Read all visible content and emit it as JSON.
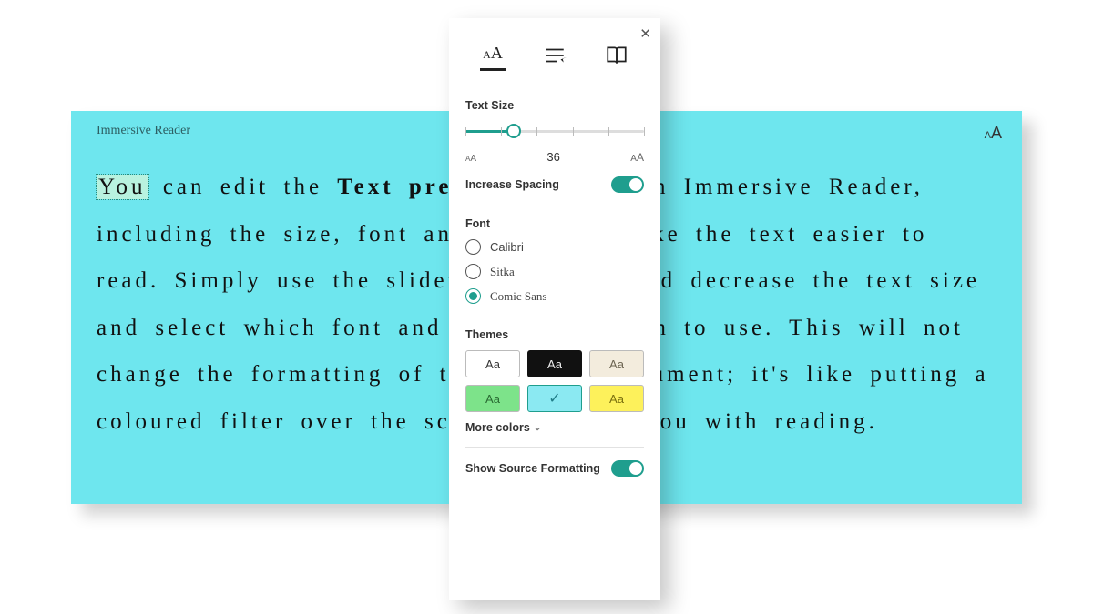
{
  "reader": {
    "title": "Immersive Reader",
    "highlighted_word": "You",
    "body_rest": " can edit the ",
    "bold_fragment": "Text preferences",
    "body_after": " here in Immersive Reader, including the size, font and colour to make the text easier to read. Simply use the slider to increase and decrease the text size and select which font and colour you wish to use. This will not change the formatting of the original document; it's like putting a coloured filter over the screen to assist you with reading."
  },
  "panel": {
    "tabs": {
      "text": "Text Preferences",
      "grammar": "Grammar Options",
      "reading": "Reading Preferences"
    },
    "text_size": {
      "label": "Text Size",
      "value": 36,
      "min": 14,
      "max": 96,
      "small_icon": "A",
      "large_icon": "A"
    },
    "increase_spacing": {
      "label": "Increase Spacing",
      "on": true
    },
    "font": {
      "label": "Font",
      "options": [
        "Calibri",
        "Sitka",
        "Comic Sans"
      ],
      "selected": "Comic Sans"
    },
    "themes": {
      "label": "Themes",
      "sample": "Aa",
      "selected": "cyan",
      "more_label": "More colors"
    },
    "source_formatting": {
      "label": "Show Source Formatting",
      "on": true
    }
  }
}
